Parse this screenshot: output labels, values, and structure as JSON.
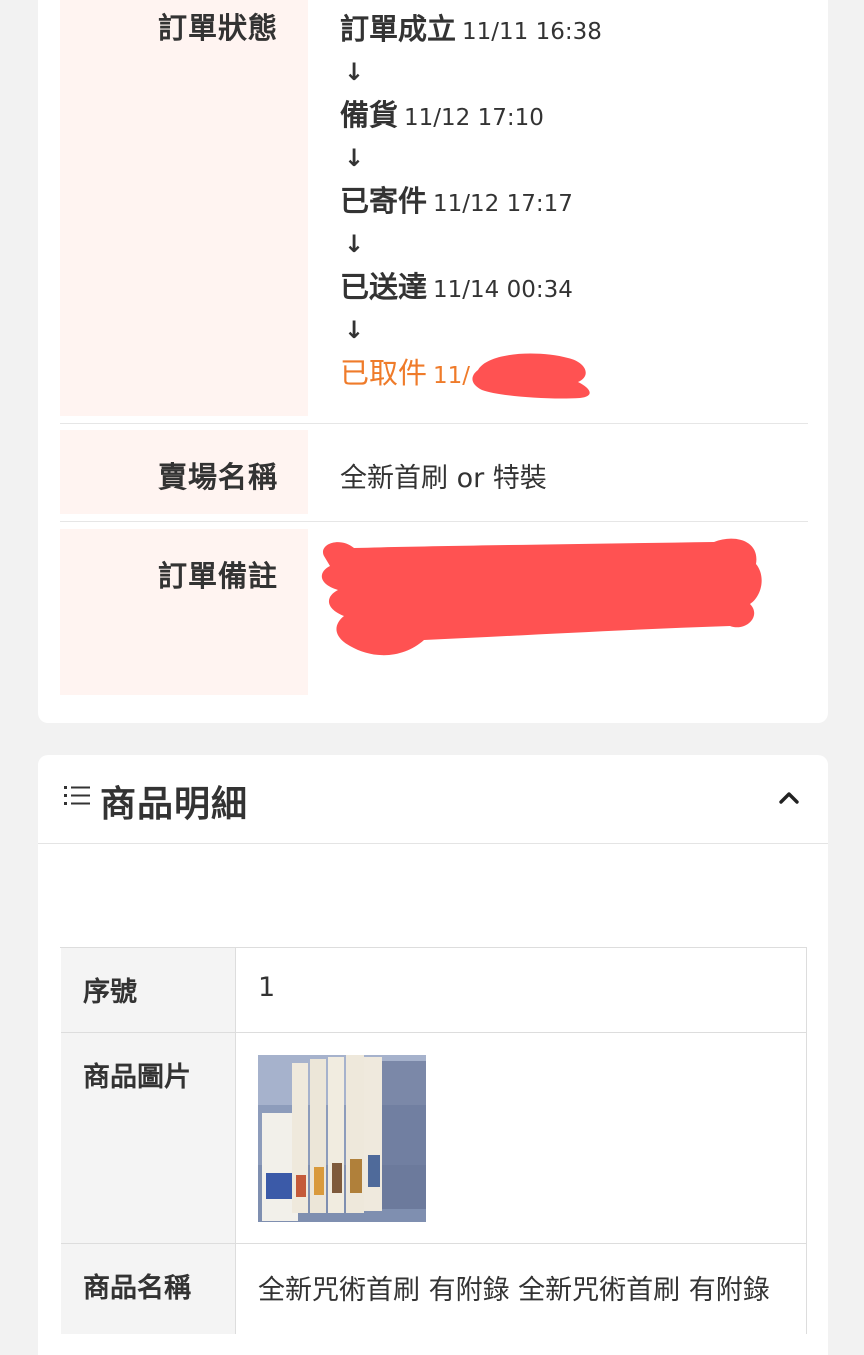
{
  "order_info": {
    "status_label": "訂單狀態",
    "status_steps": [
      {
        "name": "訂單成立",
        "time": "11/11 16:38"
      },
      {
        "name": "備貨",
        "time": "11/12 17:10"
      },
      {
        "name": "已寄件",
        "time": "11/12 17:17"
      },
      {
        "name": "已送達",
        "time": "11/14 00:34"
      },
      {
        "name": "已取件",
        "time": "11/"
      }
    ],
    "arrow_glyph": "↓",
    "store_label": "賣場名稱",
    "store_value": "全新首刷 or 特裝",
    "note_label": "訂單備註",
    "note_value": ""
  },
  "product_details": {
    "title": "商品明細",
    "icons": {
      "list": "list-icon",
      "collapse": "chevron-up-icon"
    },
    "rows": {
      "serial_label": "序號",
      "serial_value": "1",
      "image_label": "商品圖片",
      "image_alt": "",
      "name_label": "商品名稱",
      "name_value": "全新咒術首刷 有附錄 全新咒術首刷 有附錄"
    }
  },
  "colors": {
    "accent_orange": "#ef7b2a",
    "label_bg": "#fff4f1",
    "redaction": "#ff5252"
  }
}
